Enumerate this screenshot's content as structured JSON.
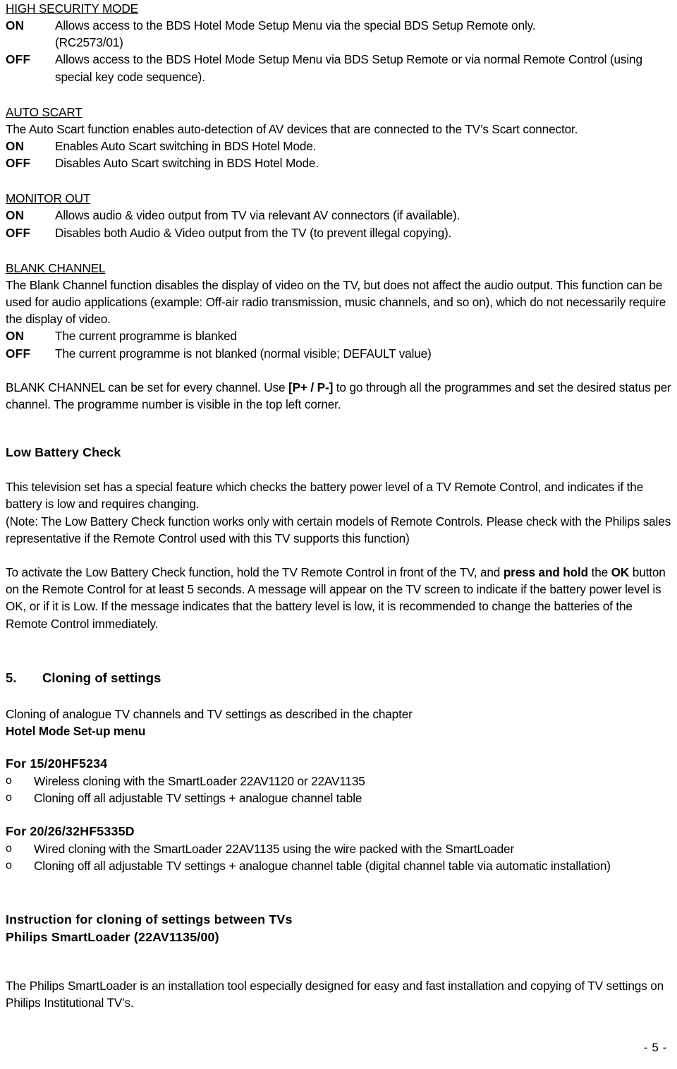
{
  "document": {
    "page_number_label": "- 5 -"
  },
  "sections": {
    "high_security_mode": {
      "heading": "HIGH SECURITY MODE",
      "on_label": "ON",
      "on_text": "Allows access to the BDS Hotel Mode Setup Menu via the special BDS Setup Remote only.",
      "on_text_line2": "(RC2573/01)",
      "off_label": "OFF",
      "off_text": "Allows access to the BDS Hotel Mode Setup Menu via BDS Setup Remote or via normal Remote Control (using special key code sequence)."
    },
    "auto_scart": {
      "heading": "AUTO SCART",
      "intro": "The Auto Scart function enables auto-detection of AV devices that are connected to the TV’s Scart connector.",
      "on_label": "ON",
      "on_text": "Enables Auto Scart switching in BDS Hotel Mode.",
      "off_label": "OFF",
      "off_text": "Disables Auto Scart switching in BDS Hotel Mode."
    },
    "monitor_out": {
      "heading": "MONITOR OUT",
      "on_label": "ON",
      "on_text": "Allows audio & video output from TV via relevant AV connectors (if available).",
      "off_label": "OFF",
      "off_text": "Disables both Audio & Video output from the TV (to prevent illegal copying)."
    },
    "blank_channel": {
      "heading": "BLANK CHANNEL",
      "intro": "The Blank Channel function disables the display of video on the TV, but does not affect the audio output. This function can be used for audio applications (example: Off-air radio transmission, music channels, and so on), which do not necessarily require the display of video.",
      "on_label": "ON",
      "on_text": "The current programme is blanked",
      "off_label": "OFF",
      "off_text": "The current programme is not blanked (normal visible; DEFAULT value)",
      "note_part1": "BLANK CHANNEL can be set for every channel. Use ",
      "note_keys": "[P+ / P-]",
      "note_part2": " to go through all the programmes and set the desired status per channel. The programme number is visible in the top left corner."
    },
    "low_battery_check": {
      "heading": "Low Battery Check",
      "para1": "This television set has a special feature which checks the battery power level of a TV Remote Control, and indicates if the battery is low and requires changing.",
      "para2": "(Note: The Low Battery Check function works only with certain models of Remote Controls. Please check with the Philips sales representative if the Remote Control used with this TV supports this function)",
      "para3_part1": "To activate the Low Battery Check function, hold the TV Remote Control in front of the TV, and ",
      "para3_bold1": "press and hold",
      "para3_part2": " the ",
      "para3_bold2": "OK",
      "para3_part3": " button on the Remote Control for at least 5 seconds. A message will appear on the TV screen to indicate if the battery power level is OK, or if it is Low. If the message indicates that the battery level is low, it is recommended to change the batteries of the Remote Control immediately."
    },
    "cloning": {
      "number": "5.",
      "heading": "Cloning of settings",
      "intro_line1": "Cloning of analogue TV channels and TV settings as described in the chapter",
      "intro_line2_bold": "Hotel Mode Set-up menu",
      "group1": {
        "heading": "For 15/20HF5234",
        "bullet_marker": "o",
        "items": [
          "Wireless cloning with the SmartLoader 22AV1120 or 22AV1135",
          "Cloning off all adjustable TV settings + analogue channel table"
        ]
      },
      "group2": {
        "heading": "For 20/26/32HF5335D",
        "bullet_marker": "o",
        "items": [
          "Wired cloning with the SmartLoader 22AV1135 using the wire packed with the SmartLoader",
          "Cloning off all adjustable TV settings + analogue channel table (digital channel table via automatic installation)"
        ]
      },
      "instruction_line1": "Instruction for cloning of settings between TVs",
      "instruction_line2": "Philips SmartLoader (22AV1135/00)",
      "closing_para": "The Philips SmartLoader is an installation tool especially designed for easy and fast installation and copying of TV settings on Philips Institutional TV’s."
    }
  }
}
